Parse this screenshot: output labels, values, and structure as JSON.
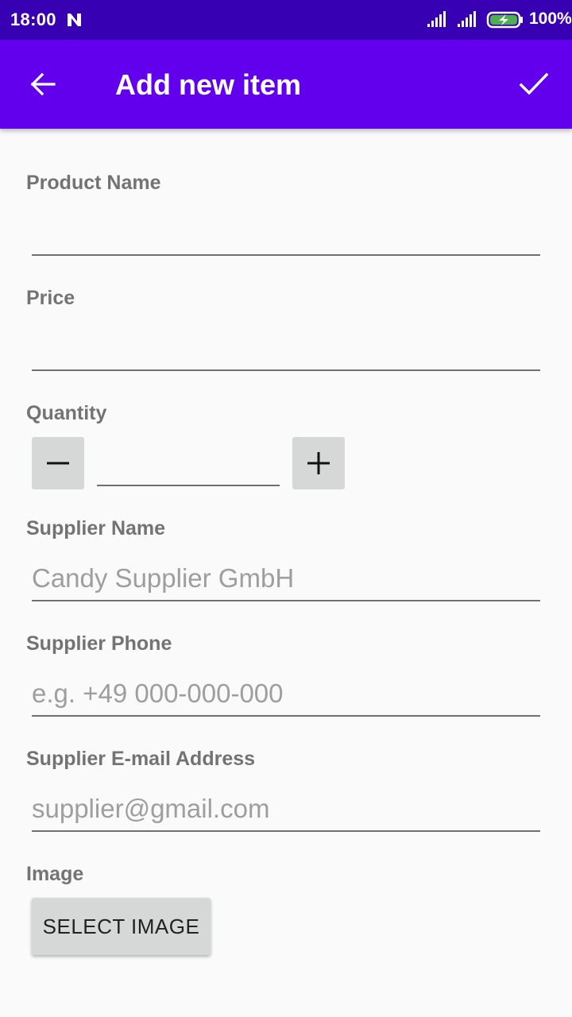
{
  "status_bar": {
    "time": "18:00",
    "battery_percent": "100%",
    "icons": [
      "notification-n-icon",
      "signal-icon",
      "signal-icon",
      "battery-charging-icon"
    ]
  },
  "app_bar": {
    "title": "Add new item",
    "back_icon": "arrow-back-icon",
    "save_icon": "check-icon",
    "color": "#6200ee"
  },
  "form": {
    "product_name": {
      "label": "Product Name",
      "value": "",
      "placeholder": ""
    },
    "price": {
      "label": "Price",
      "value": "",
      "placeholder": ""
    },
    "quantity": {
      "label": "Quantity",
      "value": "",
      "decrement_icon": "minus-icon",
      "increment_icon": "plus-icon"
    },
    "supplier_name": {
      "label": "Supplier Name",
      "value": "",
      "placeholder": "Candy Supplier GmbH"
    },
    "supplier_phone": {
      "label": "Supplier Phone",
      "value": "",
      "placeholder": "e.g. +49 000-000-000"
    },
    "supplier_email": {
      "label": "Supplier E-mail Address",
      "value": "",
      "placeholder": "supplier@gmail.com"
    },
    "image": {
      "label": "Image",
      "button_label": "SELECT IMAGE"
    }
  },
  "colors": {
    "status_bar": "#3700b3",
    "app_bar": "#6200ee",
    "label": "#737373",
    "hint": "#9e9e9e",
    "button_bg": "#d6d7d7"
  }
}
